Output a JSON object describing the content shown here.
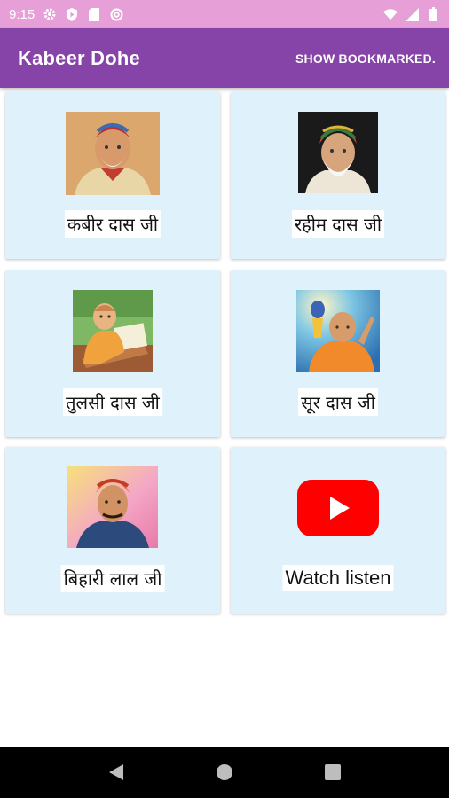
{
  "status_bar": {
    "time": "9:15",
    "left_icons": [
      "settings-icon",
      "shield-play-icon",
      "sd-card-icon",
      "at-sign-icon"
    ],
    "right_icons": [
      "wifi-icon",
      "signal-icon",
      "battery-icon"
    ]
  },
  "app_bar": {
    "title": "Kabeer Dohe",
    "action_label": "SHOW BOOKMARKED."
  },
  "cards": [
    {
      "label": "कबीर दास जी",
      "image": "kabir-portrait"
    },
    {
      "label": "रहीम दास जी",
      "image": "rahim-portrait"
    },
    {
      "label": "तुलसी दास जी",
      "image": "tulsi-portrait"
    },
    {
      "label": "सूर दास जी",
      "image": "surdas-portrait"
    },
    {
      "label": "बिहारी लाल जी",
      "image": "bihari-portrait"
    },
    {
      "label": "Watch listen",
      "image": "youtube-icon"
    }
  ],
  "nav_bar": {
    "buttons": [
      "back-icon",
      "home-icon",
      "recents-icon"
    ]
  },
  "colors": {
    "status_bar": "#e79fd8",
    "app_bar": "#8643a8",
    "card_bg": "#dff1fb",
    "youtube_red": "#ff0000"
  }
}
